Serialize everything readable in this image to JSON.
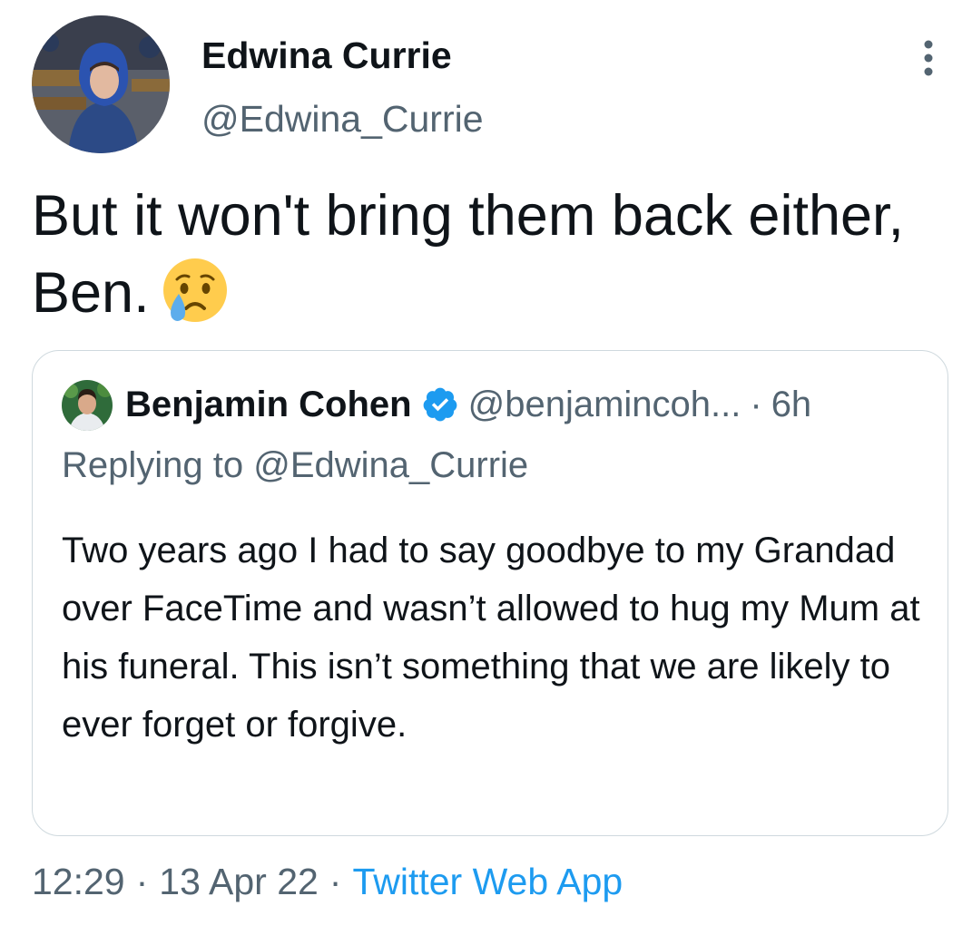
{
  "tweet": {
    "author": {
      "name": "Edwina Currie",
      "handle": "@Edwina_Currie"
    },
    "text": "But it won't bring them back either, Ben.",
    "emoji_icon": "crying-face-icon",
    "more_icon": "more-options-icon"
  },
  "quoted_tweet": {
    "author": {
      "name": "Benjamin Cohen",
      "handle": "@benjamincoh...",
      "verified_icon": "verified-badge-icon"
    },
    "separator": "·",
    "time": "6h",
    "replying_to": "Replying to @Edwina_Currie",
    "text": "Two years ago I had to say goodbye to my Grandad over FaceTime and wasn’t allowed to hug my Mum at his funeral. This isn’t something that we are likely to ever forget or forgive."
  },
  "footer": {
    "time": "12:29",
    "separator": "·",
    "date": "13 Apr 22",
    "source": "Twitter Web App"
  },
  "colors": {
    "text_primary": "#0f1419",
    "text_secondary": "#536471",
    "accent": "#1d9bf0",
    "border": "#cfd9de"
  }
}
